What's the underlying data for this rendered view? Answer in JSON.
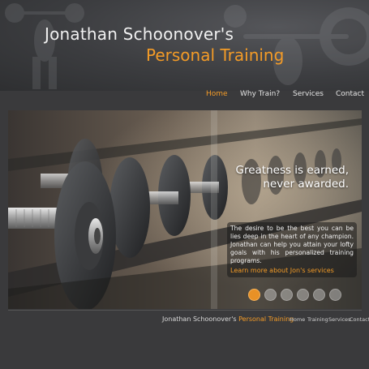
{
  "brand": {
    "line1": "Jonathan Schoonover's",
    "line2": "Personal Training"
  },
  "nav": {
    "items": [
      {
        "label": "Home",
        "active": true
      },
      {
        "label": "Why Train?",
        "active": false
      },
      {
        "label": "Services",
        "active": false
      },
      {
        "label": "Contact",
        "active": false
      }
    ]
  },
  "hero": {
    "quote_line1": "Greatness is earned,",
    "quote_line2": "never awarded.",
    "info_text": "The desire to be the best you can be lies deep in the heart of any champion. Jonathan can help you attain your lofty goals with his personalized training programs.",
    "info_link": "Learn more about Jon's services",
    "slider": {
      "count": 6,
      "active_index": 0
    }
  },
  "footer": {
    "brand_name": "Jonathan Schoonover's",
    "brand_accent": "Personal Training",
    "links": [
      "Home",
      "Training",
      "Services",
      "Contact"
    ]
  },
  "colors": {
    "accent": "#f39b27",
    "background": "#3a3a3c",
    "text": "#f0f0f0"
  }
}
